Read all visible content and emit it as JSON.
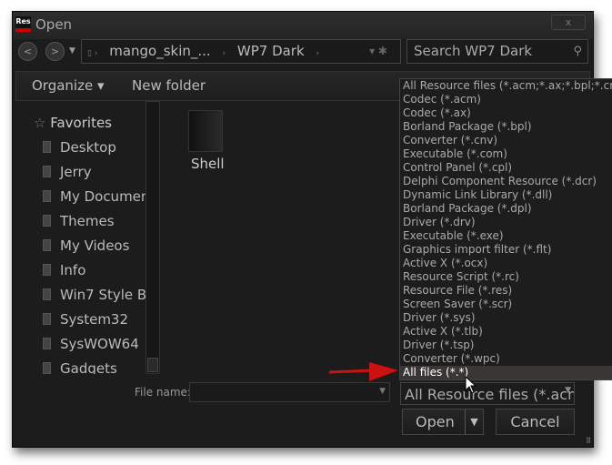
{
  "window": {
    "title": "Open",
    "app_icon": "Res",
    "close": "x"
  },
  "nav": {
    "back": "<",
    "forward": ">",
    "breadcrumb": [
      "mango_skin_...",
      "WP7 Dark"
    ],
    "search_placeholder": "Search WP7 Dark"
  },
  "toolbar": {
    "organize": "Organize ▾",
    "new_folder": "New folder"
  },
  "sidebar": {
    "favorites": "Favorites",
    "items": [
      "Desktop",
      "Jerry",
      "My Documents",
      "Themes",
      "My Videos",
      "Info",
      "Win7 Style B",
      "System32",
      "SysWOW64",
      "Gadgets"
    ]
  },
  "content": {
    "items": [
      {
        "name": "Shell"
      }
    ]
  },
  "footer": {
    "file_name_label": "File name:",
    "file_name_value": "",
    "filter_value": "All Resource files (*.acm;*.ax;*.bpl;*.cnv;*.com",
    "open": "Open",
    "cancel": "Cancel"
  },
  "dropdown": {
    "selected": "All files (*.*)",
    "options": [
      "All Resource files (*.acm;*.ax;*.bpl;*.cnv;*.com",
      "Codec (*.acm)",
      "Codec (*.ax)",
      "Borland Package (*.bpl)",
      "Converter (*.cnv)",
      "Executable (*.com)",
      "Control Panel (*.cpl)",
      "Delphi Component Resource (*.dcr)",
      "Dynamic Link Library (*.dll)",
      "Borland Package (*.dpl)",
      "Driver (*.drv)",
      "Executable (*.exe)",
      "Graphics import filter (*.flt)",
      "Active X (*.ocx)",
      "Resource Script (*.rc)",
      "Resource File (*.res)",
      "Screen Saver (*.scr)",
      "Driver (*.sys)",
      "Active X (*.tlb)",
      "Driver (*.tsp)",
      "Converter (*.wpc)",
      "All files (*.*)"
    ]
  },
  "colors": {
    "background": "#1c1c1c",
    "arrow": "#cc1111",
    "selected_item": "#3a3636"
  }
}
